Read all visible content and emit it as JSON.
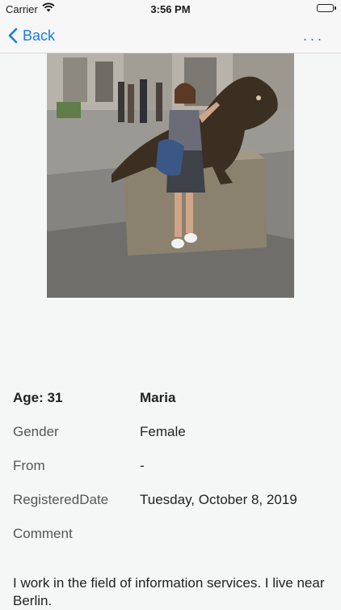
{
  "status_bar": {
    "carrier": "Carrier",
    "time": "3:56 PM"
  },
  "nav": {
    "back_label": "Back",
    "more_label": "..."
  },
  "profile": {
    "age_label": "Age:",
    "age_value": "31",
    "name": "Maria",
    "gender_label": "Gender",
    "gender_value": "Female",
    "from_label": "From",
    "from_value": "-",
    "registered_label": "RegisteredDate",
    "registered_value": "Tuesday, October 8, 2019",
    "comment_label": "Comment",
    "comment_text": "I work in the field of information services. I live near Berlin."
  },
  "colors": {
    "accent": "#1a7ce0",
    "background": "#f5f6f6"
  },
  "icons": {
    "back": "chevron-left-icon",
    "wifi": "wifi-icon",
    "battery": "battery-icon"
  }
}
